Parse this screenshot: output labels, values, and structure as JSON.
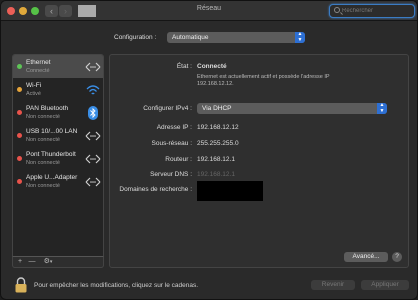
{
  "window": {
    "title": "Réseau"
  },
  "search": {
    "placeholder": "Rechercher"
  },
  "configuration": {
    "label": "Configuration :",
    "value": "Automatique"
  },
  "services": [
    {
      "name": "Ethernet",
      "status": "Connecté",
      "dot_color": "#5ec456",
      "icon": "ethernet-arrows-icon",
      "selected": true
    },
    {
      "name": "Wi-Fi",
      "status": "Activé",
      "dot_color": "#e6a43a",
      "icon": "wifi-icon"
    },
    {
      "name": "PAN Bluetooth",
      "status": "Non connecté",
      "dot_color": "#e8534b",
      "icon": "bluetooth-icon"
    },
    {
      "name": "USB 10/...00 LAN",
      "status": "Non connecté",
      "dot_color": "#e8534b",
      "icon": "ethernet-arrows-icon"
    },
    {
      "name": "Pont Thunderbolt",
      "status": "Non connecté",
      "dot_color": "#e8534b",
      "icon": "ethernet-arrows-icon"
    },
    {
      "name": "Apple U...Adapter",
      "status": "Non connecté",
      "dot_color": "#e8534b",
      "icon": "ethernet-arrows-icon"
    }
  ],
  "sidebar_buttons": {
    "add": "+",
    "remove": "—",
    "action": "⚙"
  },
  "details": {
    "state_label": "État :",
    "state_value": "Connecté",
    "state_description": "Ethernet est actuellement actif et possède l'adresse IP 192.168.12.12.",
    "ipv4_label": "Configurer IPv4 :",
    "ipv4_value": "Via DHCP",
    "ip_label": "Adresse IP :",
    "ip_value": "192.168.12.12",
    "subnet_label": "Sous-réseau :",
    "subnet_value": "255.255.255.0",
    "router_label": "Routeur :",
    "router_value": "192.168.12.1",
    "dns_label": "Serveur DNS :",
    "dns_value": "192.168.12.1",
    "search_domains_label": "Domaines de recherche :"
  },
  "buttons": {
    "advanced": "Avancé...",
    "help": "?",
    "revert": "Revenir",
    "apply": "Appliquer"
  },
  "footer": {
    "lock_text": "Pour empêcher les modifications, cliquez sur le cadenas."
  },
  "colors": {
    "accent": "#2d6fd3",
    "connected": "#5ec456",
    "warning": "#e6a43a",
    "disconnected": "#e8534b"
  }
}
